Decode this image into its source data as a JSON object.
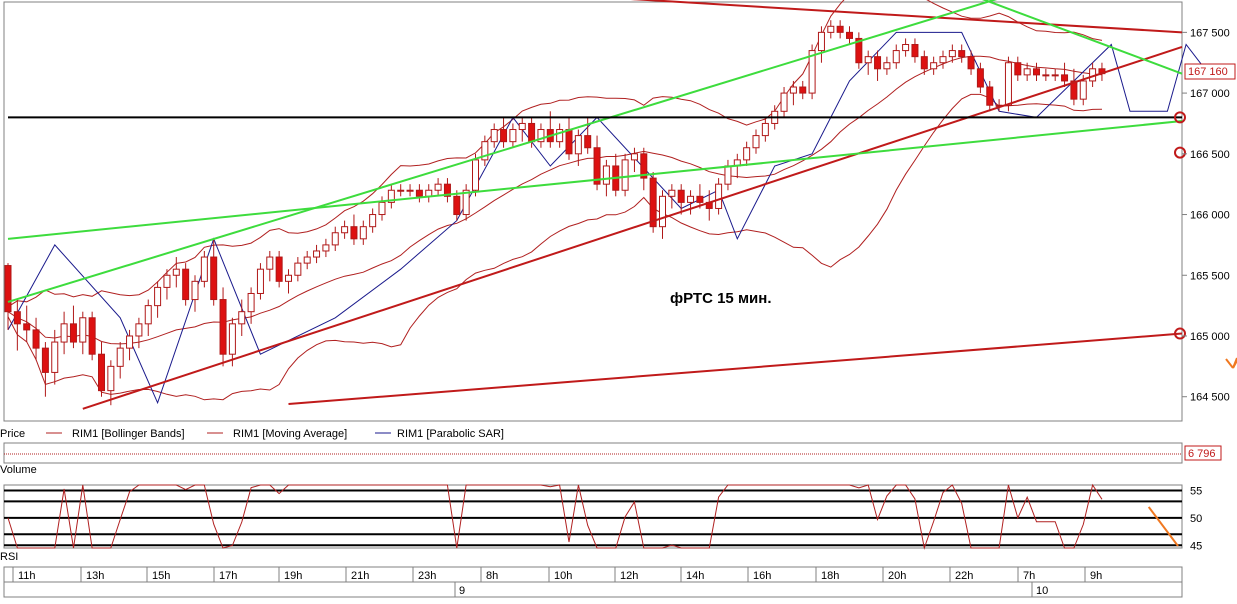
{
  "chart_data": {
    "type": "candlestick",
    "annotation": "фРТС   15 мин.",
    "price_axis": {
      "ticks": [
        164500,
        165000,
        165500,
        166000,
        166500,
        167000,
        167500
      ],
      "tick_labels": [
        "164 500",
        "165 000",
        "165 500",
        "166 000",
        "166 500",
        "167 000",
        "167 500"
      ],
      "ylim": [
        164300,
        167750
      ],
      "last_price": 167160,
      "last_price_label": "167 160"
    },
    "legend": {
      "price_label": "Price",
      "items": [
        {
          "name": "RIM1 [Bollinger Bands]",
          "color": "#b02020"
        },
        {
          "name": "RIM1 [Moving Average]",
          "color": "#b02020"
        },
        {
          "name": "RIM1 [Parabolic SAR]",
          "color": "#1a1a8c"
        }
      ]
    },
    "volume": {
      "label": "Volume",
      "last_value_label": "6 796"
    },
    "rsi": {
      "label": "RSI",
      "ticks": [
        45,
        50,
        55
      ],
      "tick_labels": [
        "45",
        "50",
        "55"
      ],
      "ylim": [
        44.5,
        56
      ],
      "levels": [
        45,
        47,
        50,
        53,
        55
      ]
    },
    "time_axis": {
      "hour_labels": [
        "11h",
        "13h",
        "15h",
        "17h",
        "19h",
        "21h",
        "23h",
        "8h",
        "10h",
        "12h",
        "14h",
        "16h",
        "18h",
        "20h",
        "22h",
        "7h",
        "9h"
      ],
      "day_labels": [
        "9",
        "10"
      ]
    },
    "candles": [
      [
        165580,
        165600,
        165050,
        165200
      ],
      [
        165200,
        165300,
        164880,
        165100
      ],
      [
        165100,
        165250,
        164950,
        165050
      ],
      [
        165050,
        165150,
        164800,
        164900
      ],
      [
        164900,
        164950,
        164500,
        164700
      ],
      [
        164700,
        165050,
        164600,
        164950
      ],
      [
        164950,
        165200,
        164850,
        165100
      ],
      [
        165100,
        165250,
        164900,
        164950
      ],
      [
        164950,
        165200,
        164850,
        165150
      ],
      [
        165150,
        165200,
        164800,
        164850
      ],
      [
        164850,
        164950,
        164500,
        164550
      ],
      [
        164550,
        164800,
        164430,
        164750
      ],
      [
        164750,
        164950,
        164650,
        164900
      ],
      [
        164900,
        165050,
        164800,
        165000
      ],
      [
        165000,
        165150,
        164900,
        165100
      ],
      [
        165100,
        165300,
        165000,
        165250
      ],
      [
        165250,
        165450,
        165150,
        165400
      ],
      [
        165400,
        165550,
        165300,
        165500
      ],
      [
        165500,
        165650,
        165400,
        165550
      ],
      [
        165550,
        165600,
        165250,
        165300
      ],
      [
        165300,
        165500,
        165200,
        165450
      ],
      [
        165450,
        165700,
        165400,
        165650
      ],
      [
        165650,
        165800,
        165250,
        165300
      ],
      [
        165300,
        165400,
        164750,
        164850
      ],
      [
        164850,
        165150,
        164750,
        165100
      ],
      [
        165100,
        165300,
        165000,
        165200
      ],
      [
        165200,
        165400,
        165100,
        165350
      ],
      [
        165350,
        165600,
        165300,
        165550
      ],
      [
        165550,
        165700,
        165450,
        165650
      ],
      [
        165650,
        165700,
        165400,
        165450
      ],
      [
        165450,
        165550,
        165350,
        165500
      ],
      [
        165500,
        165650,
        165450,
        165600
      ],
      [
        165600,
        165700,
        165550,
        165650
      ],
      [
        165650,
        165750,
        165600,
        165700
      ],
      [
        165700,
        165800,
        165650,
        165750
      ],
      [
        165750,
        165900,
        165700,
        165850
      ],
      [
        165850,
        165950,
        165800,
        165900
      ],
      [
        165900,
        166000,
        165750,
        165800
      ],
      [
        165800,
        165950,
        165750,
        165900
      ],
      [
        165900,
        166050,
        165850,
        166000
      ],
      [
        166000,
        166150,
        165950,
        166100
      ],
      [
        166100,
        166250,
        166050,
        166200
      ],
      [
        166200,
        166250,
        166150,
        166200
      ],
      [
        166200,
        166250,
        166150,
        166200
      ],
      [
        166200,
        166250,
        166100,
        166150
      ],
      [
        166150,
        166250,
        166100,
        166200
      ],
      [
        166200,
        166300,
        166150,
        166250
      ],
      [
        166250,
        166300,
        166100,
        166150
      ],
      [
        166150,
        166200,
        165950,
        166000
      ],
      [
        166000,
        166250,
        165950,
        166200
      ],
      [
        166200,
        166500,
        166150,
        166450
      ],
      [
        166450,
        166650,
        166400,
        166600
      ],
      [
        166600,
        166750,
        166550,
        166700
      ],
      [
        166700,
        166800,
        166550,
        166600
      ],
      [
        166600,
        166750,
        166550,
        166700
      ],
      [
        166700,
        166800,
        166600,
        166750
      ],
      [
        166750,
        166800,
        166550,
        166600
      ],
      [
        166600,
        166750,
        166550,
        166700
      ],
      [
        166700,
        166850,
        166550,
        166600
      ],
      [
        166600,
        166750,
        166550,
        166700
      ],
      [
        166700,
        166800,
        166450,
        166500
      ],
      [
        166500,
        166700,
        166400,
        166650
      ],
      [
        166650,
        166800,
        166500,
        166550
      ],
      [
        166550,
        166650,
        166200,
        166250
      ],
      [
        166250,
        166450,
        166150,
        166400
      ],
      [
        166400,
        166500,
        166150,
        166200
      ],
      [
        166200,
        166500,
        166150,
        166450
      ],
      [
        166450,
        166550,
        166350,
        166500
      ],
      [
        166500,
        166550,
        166200,
        166300
      ],
      [
        166300,
        166350,
        165850,
        165900
      ],
      [
        165900,
        166200,
        165800,
        166150
      ],
      [
        166150,
        166250,
        166050,
        166200
      ],
      [
        166200,
        166250,
        166000,
        166100
      ],
      [
        166100,
        166200,
        166000,
        166150
      ],
      [
        166150,
        166250,
        166050,
        166100
      ],
      [
        166100,
        166200,
        165950,
        166050
      ],
      [
        166050,
        166300,
        166000,
        166250
      ],
      [
        166250,
        166450,
        166200,
        166400
      ],
      [
        166400,
        166500,
        166300,
        166450
      ],
      [
        166450,
        166600,
        166400,
        166550
      ],
      [
        166550,
        166700,
        166500,
        166650
      ],
      [
        166650,
        166800,
        166600,
        166750
      ],
      [
        166750,
        166900,
        166700,
        166850
      ],
      [
        166850,
        167050,
        166800,
        167000
      ],
      [
        167000,
        167100,
        166900,
        167050
      ],
      [
        167050,
        167100,
        166950,
        167000
      ],
      [
        167000,
        167400,
        166950,
        167350
      ],
      [
        167350,
        167550,
        167250,
        167500
      ],
      [
        167500,
        167600,
        167450,
        167550
      ],
      [
        167550,
        167600,
        167450,
        167500
      ],
      [
        167500,
        167550,
        167400,
        167450
      ],
      [
        167450,
        167500,
        167200,
        167250
      ],
      [
        167250,
        167350,
        167150,
        167300
      ],
      [
        167300,
        167350,
        167100,
        167200
      ],
      [
        167200,
        167300,
        167150,
        167250
      ],
      [
        167250,
        167400,
        167200,
        167350
      ],
      [
        167350,
        167450,
        167300,
        167400
      ],
      [
        167400,
        167450,
        167250,
        167300
      ],
      [
        167300,
        167350,
        167150,
        167200
      ],
      [
        167200,
        167300,
        167150,
        167250
      ],
      [
        167250,
        167350,
        167200,
        167300
      ],
      [
        167300,
        167400,
        167250,
        167350
      ],
      [
        167350,
        167400,
        167250,
        167300
      ],
      [
        167300,
        167350,
        167150,
        167200
      ],
      [
        167200,
        167250,
        167000,
        167050
      ],
      [
        167050,
        167100,
        166850,
        166900
      ],
      [
        166900,
        166950,
        166850,
        166900
      ],
      [
        166900,
        167300,
        166850,
        167250
      ],
      [
        167250,
        167300,
        167100,
        167150
      ],
      [
        167150,
        167250,
        167100,
        167200
      ],
      [
        167200,
        167250,
        167100,
        167150
      ],
      [
        167150,
        167200,
        167100,
        167150
      ],
      [
        167150,
        167200,
        167100,
        167150
      ],
      [
        167150,
        167250,
        167050,
        167100
      ],
      [
        167100,
        167200,
        166900,
        166950
      ],
      [
        166950,
        167150,
        166900,
        167100
      ],
      [
        167100,
        167250,
        167050,
        167200
      ],
      [
        167200,
        167250,
        167100,
        167160
      ]
    ],
    "sar": [
      [
        0,
        165050
      ],
      [
        5,
        165750
      ],
      [
        12,
        165150
      ],
      [
        16,
        164450
      ],
      [
        22,
        165800
      ],
      [
        27,
        164850
      ],
      [
        35,
        165150
      ],
      [
        42,
        165550
      ],
      [
        48,
        165950
      ],
      [
        54,
        166800
      ],
      [
        58,
        166400
      ],
      [
        63,
        166800
      ],
      [
        72,
        166050
      ],
      [
        76,
        166200
      ],
      [
        78,
        165800
      ],
      [
        82,
        166400
      ],
      [
        86,
        166500
      ],
      [
        90,
        167100
      ],
      [
        95,
        167500
      ],
      [
        102,
        167500
      ],
      [
        106,
        166850
      ],
      [
        110,
        166800
      ],
      [
        118,
        167400
      ],
      [
        120,
        166850
      ],
      [
        124,
        166850
      ],
      [
        126,
        167400
      ],
      [
        128,
        167200
      ]
    ],
    "trendlines": [
      {
        "color": "#c01a1a",
        "p1": [
          44,
          167880
        ],
        "p2": [
          177,
          167500
        ]
      },
      {
        "color": "#c01a1a",
        "p1": [
          8,
          164400
        ],
        "p2": [
          177,
          167380
        ]
      },
      {
        "color": "#c01a1a",
        "p1": [
          30,
          164440
        ],
        "p2": [
          177,
          165020
        ]
      },
      {
        "color": "#3ddc3d",
        "p1": [
          0,
          165280
        ],
        "p2": [
          106,
          167780
        ]
      },
      {
        "color": "#3ddc3d",
        "p1": [
          0,
          165800
        ],
        "p2": [
          177,
          166770
        ]
      },
      {
        "color": "#3ddc3d",
        "p1": [
          104,
          167780
        ],
        "p2": [
          177,
          167160
        ]
      },
      {
        "color": "#000000",
        "p1": [
          0,
          166800
        ],
        "p2": [
          177,
          166800
        ]
      }
    ],
    "projection_arrows": [
      {
        "color": "#f07820",
        "p1": [
          148,
          167130
        ],
        "p2": [
          177,
          164750
        ]
      }
    ]
  }
}
